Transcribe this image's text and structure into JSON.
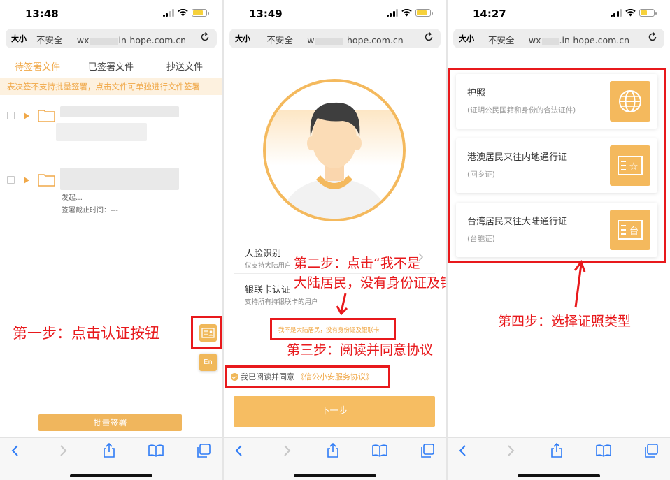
{
  "url_display": {
    "aa": "大小",
    "left": "不安全 — wx",
    "right1": "in-hope.com.cn",
    "right2": "-hope.com.cn",
    "right3": ".in-hope.com.cn",
    "left3": "不安全 — wx"
  },
  "phone1": {
    "time": "13:48",
    "tabs": [
      "待签署文件",
      "已签署文件",
      "抄送文件"
    ],
    "notice": "表决签不支持批量签署，点击文件可单独进行文件签署",
    "row_fragments": {
      "text1": "发起…",
      "deadline": "签署截止时间：---"
    },
    "en_label": "En",
    "batch_button": "批量签署",
    "annotation": "第一步：点击认证按钮"
  },
  "phone2": {
    "time": "13:49",
    "options": [
      {
        "title": "人脸识别",
        "sub": "仅支持大陆用户"
      },
      {
        "title": "银联卡认证",
        "sub": "支持所有持银联卡的用户"
      }
    ],
    "not_mainland": "我不是大陆居民，没有身份证及银联卡",
    "agree_prefix": "我已阅读并同意",
    "agree_link": "《信公小安服务协议》",
    "next_button": "下一步",
    "annotation_step2_line1": "第二步：点击“我不是",
    "annotation_step2_line2": "大陆居民，没有身份证及银联卡”",
    "annotation_step3": "第三步：阅读并同意协议"
  },
  "phone3": {
    "time": "14:27",
    "cards": [
      {
        "title": "护照",
        "sub": "(证明公民国籍和身份的合法证件)",
        "icon": "globe-icon"
      },
      {
        "title": "港澳居民来往内地通行证",
        "sub": "(回乡证)",
        "icon": "hk-permit-icon"
      },
      {
        "title": "台湾居民来往大陆通行证",
        "sub": "(台胞证)",
        "icon": "tw-permit-icon"
      }
    ],
    "icon_glyphs": [
      "☆",
      "台"
    ],
    "annotation": "第四步：选择证照类型"
  },
  "colors": {
    "accent": "#f0a848",
    "annotation_red": "#e8191c",
    "button": "#f6bd62"
  }
}
